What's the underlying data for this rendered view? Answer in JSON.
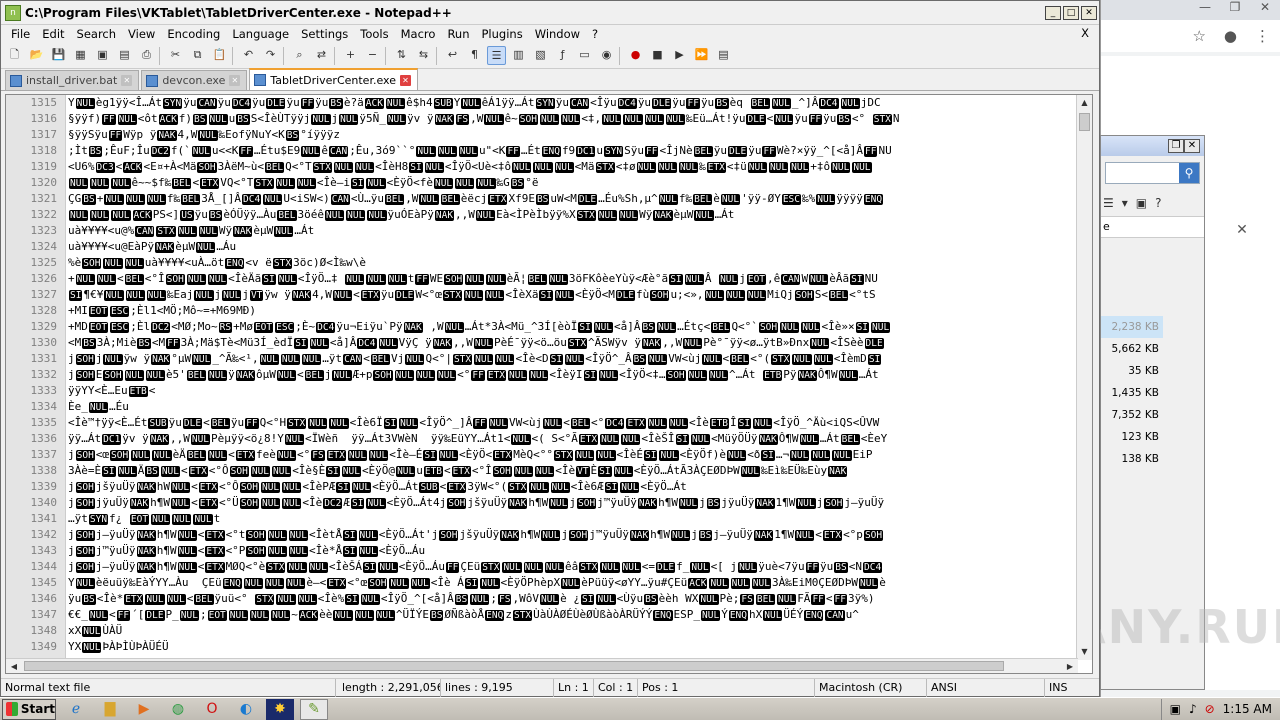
{
  "window": {
    "title": "C:\\Program Files\\VKTablet\\TabletDriverCenter.exe - Notepad++",
    "menu": [
      "File",
      "Edit",
      "Search",
      "View",
      "Encoding",
      "Language",
      "Settings",
      "Tools",
      "Macro",
      "Run",
      "Plugins",
      "Window",
      "?"
    ],
    "menu_close": "X"
  },
  "tabs": [
    {
      "label": "install_driver.bat",
      "active": false
    },
    {
      "label": "devcon.exe",
      "active": false
    },
    {
      "label": "TabletDriverCenter.exe",
      "active": true
    }
  ],
  "editor": {
    "line_numbers": [
      "1315",
      "1316",
      "1317",
      "1318",
      "1319",
      "1320",
      "1321",
      "1322",
      "1323",
      "1324",
      "1325",
      "1326",
      "1327",
      "1328",
      "1329",
      "1330",
      "1331",
      "1332",
      "1333",
      "1334",
      "1335",
      "1336",
      "1337",
      "1338",
      "1339",
      "1340",
      "1341",
      "1342",
      "1343",
      "1344",
      "1345",
      "1346",
      "1347",
      "1348",
      "1349"
    ],
    "lines": [
      "YNULèg1ÿÿ<Î…ÁtSYNÿuCANÿuDC4ÿuDLEÿuFFÿuBSè?äACKNULê$h4SUBYNULê­Á1ÿÿ…ÁtSYNÿuCAN<ÎÿuDC4ÿuDLEÿuFFÿuBSèq BELNUL_^]ÂDC4NULjDC",
      "§ÿÿf)FFNUL<ôtACKf)BSNULuBSS<ÎèÙTÿÿjNULjNULÿ5Ñ_NULÿv ÿNAKFS,WNULê~SOHNULNUL<‡,NULNULNULNUL‰Eü…Át!ÿuDLE<NULÿuFFÿuBS<° STXN",
      "§ÿÿSÿuFFWÿp ÿNAK4,WNUL‰EofÿNuY<KBS°íÿÿÿz",
      ";ÌtBS;ÊuF;ÎuDC2f(`NULu<<KFF…Étu$E9NULêCAN;Êu,3ó9``°NULNULNULu\"<KFF…ÉtENQf9DC1uSYNSÿuFF<ÎjNèBELÿuDLEÿuFFWè?×ÿÿ_^[<å]ÂFFNU",
      "<U6%DC3<ACK<E¤+À<MäSOH3ÀëM~ù<BELQ<°TSTXNULNUL<ÎèH8SINUL<ÎÿÖ<Uè<‡ôNULNULNUL<MäSTX<‡øNULNULNUL‰ETX<‡üNULNULNUL+‡ôNULNUL",
      "NULNULNULê~~$f‰BEL<ETXVQ<°TSTXNULNUL<Îè–iSINUL<ÈÿÖ<fèNULNULNUL‰GBS°ë",
      "ÇGBS+NULNULNULf‰BEL3Å_[]ÂDC4NULU<iSW<)CAN<Ù…ÿuBEL,WNULBELèëcjETXXf9EBSuW<MDLE…Éu%Sh,µ^NULf‰BELèNUL'ÿÿ-ØYESC‰%NULÿÿÿÿENQ",
      "NULNULNULACKPS<]USÿuBSèÓÜÿÿ…ÀuBEL3öéêNULNULNULÿuÓEàPÿNAK,,WNULEà<ÌPèÌbÿÿ%XSTXNULNULWÿNAKèµWNUL…Át",
      "uà¥¥¥¥<u@%CANSTXNULNULWÿNAKèµWNUL…Át",
      "uà¥¥¥¥<u@EàPÿNAKèµWNUL…Áu",
      "%èSOHNULNULuà¥¥¥¥<uÀ…ötENQ<v ëSTX3öc)Ø<Ì‰w\\è",
      "+NULNUL<BEL<°ÎSOHNULNUL<ÎèÄãSINUL<ÎÿÖ…‡ NULNULNULtFFWESOHNULNULèÃ¦BELNUL3öFKôèeYùÿ<Æè°ãSINULÂ NULjEOT,êCANWNULèÂãSINU",
      "SI¶€¥NULNULNUL‰EajNULjNULjVTÿw ÿNAK4,WNUL<ETXÿuDLEW<°œSTXNULNUL<ÎèXäSINUL<ÈÿÖ<MDLEfùSOHu;<»,NULNULNULMiQjSOHS<BEL<°tS",
      "+MIEOTESC;Èl1<MÖ;Mô~=+M69MÐ)",
      "+MDEOTESC;ÈlDC2<MØ;Mo~RS+MøEOTESC;È~DC4ÿu¬Eiÿu`PÿNAK ,WNUL…Át*3À<Mü_^3Í[èòÏSINUL<å]ÂBSNUL…Étç<BELQ<°`SOHNULNUL<Îè»×SINUL",
      "<MBS3À;MièBS<MFF3À;Mä$Tè<Mü3Í_èdÏSINUL<å]ÂDC4NULVÿÇ ÿNAK,,WNULPèÉ¯ÿÿ<ö…öuSTX^ÃSWÿv ÿNAK,,WNULPè°¯ÿÿ<ø…ÿtB»ÐnxNUL<ÎSèèDLE",
      "jSOHjNULÿw ÿNAK°µWNUL_^Ã‰<¹,NULNULNUL…ÿtCAN<BELVjNULQ<°|STXNULNUL<Îè<DSINUL<ÎÿÖ^_ÂBSNULVW<ùjNUL<BEL<°(STXNULNUL<ÎèmDSI",
      "jSOHESOHNULNULè5'BELNULÿNAKôµWNUL<BELjNULÆ+pSOHNULNULNUL<°FFETXNULNUL<ÎèÿISINUL<ÎÿÖ<‡…SOHNULNUL^…Át ETBPÿNAKÔ¶WNUL…Át",
      "ÿÿYY<È…EuETB<",
      "Èe_NUL…Éu",
      "<Îè™†ÿÿ<È…ÉtSUBÿuDLE<BELÿuFFQ<°HSTXNULNUL<Îè6ÏSINUL<ÎÿÖ^_]ÂFFNULVW<ùjNUL<BEL<°DC4ETXNULNUL<ÎèETBÎSINUL<ÎÿÖ_^Äù<iQS<ÛVW",
      "ÿÿ…ÁtDC1ÿv ÿNAK,,WNULPèµÿÿ<ö¿8!YNUL<ÏWèñ  ÿÿ…Át3VWèN  ÿÿ‰EüYY…Át1<NUL<( S<°ÃETXNULNUL<ÎèŠÎSINUL<MüÿÖÜÿNAKÔ¶WNUL…ÁtBEL<ÈeY",
      "jSOH<œSOHNULNULèÄBELNUL<ETXfeèNUL<°FSETXNULNUL<Îè–ÉSINUL<ÈÿÖ<ETXMèQ<°°STXNULNUL<ÎèÉSINUL<ÈÿÖf)èNUL<ðSI…¬NULNULNULEiP",
      "3Àè=ÈSINULÄBSNUL<ETX<°ÔSOHNULNUL<Îè§ÈSINUL<ÈÿÖ@NULuETB<ETX<°ÎSOHNULNUL<ÎèVTÈSINUL<ÈÿÖ…ÁtÃ3ÀÇEØDÞWNUL‰Eì‰EÜ‰EùyNAK",
      "jSOHjšÿuÜÿNAKhWNUL<ETX<°ÔSOHNULNUL<ÎèPÆSINUL<ÈÿÖ…ÁtSUB<ETX3ÿW<°(STXNULNUL<Îè6ÆSINUL<ÈÿÖ…Át",
      "jSOHjÿuÜÿNAKh¶WNUL<ETX<°ÜSOHNULNUL<ÎèDC2ÆSINUL<ÈÿÖ…Át4jSOHjšÿuÜÿNAKh¶WNULjSOHj™ÿuÜÿNAKh¶WNULjBSjÿuÜÿNAK1¶WNULjSOHj—ÿuÜÿ",
      "…ÿtSYNf¿ EOTNULNULNULt",
      "jSOHj—ÿuÜÿNAKh¶WNUL<ETX<°tSOHNULNUL<ÎètÅSINUL<ÈÿÖ…Át'jSOHjšÿuÜÿNAKh¶WNULjSOHj™ÿuÜÿNAKh¶WNULjBSj—ÿuÜÿNAK1¶WNUL<ETX<°pSOH",
      "jSOHj™ÿuÜÿNAKh¶WNUL<ETX<°PSOHNULNUL<Îè*ÅSINUL<ÈÿÖ…Áu",
      "jSOHj—ÿuÜÿNAKh¶WNUL<ETXMØQ<°èSTXNULNUL<ÎèŠÁSINUL<ÈÿÖ…ÁuFFÇEüSTXNULNULNULêâSTXNULNUL<=DLEf_NUL<[ jNULÿuè<7ÿuFFÿuBS<NDC4",
      "YNULèëuüÿ‰EàÝYY…Àu  ÇEüENQNULNULNULè–<ETX<°œSOHNULNUL<Îè ÁSINUL<ÈÿÖPhèpXNULèPüüÿ<øYY…ÿu#ÇEüACKNULNULNUL3À‰EiM0ÇEØDÞWNULè",
      "ÿuBS<Îè*ETXNULNUL<BELÿuü<° STXNULNUL<Îè%SINUL<ÎÿÖ_^[<å]ÂBSNUL;FS,WôVNULè ¿SINUL<ÙÿuBSèèh WXNULPè;FSBELNULFÃFF<FF3ÿ%)",
      "€€_NUL<FF´[DLEP_NUL;EOTNULNULNUL~ACKèèNULNULNUL^ÜÏÝEBSØÑßàòÅENQzSTXÙàÙÀØÉÙèØÙßàòÀRÜÝÝENQESP_NULÝENQhXNULÜÉÝENQCANu^",
      "xXNULÙÀÜ",
      "YXNULÞÀÞÌÙÞÀÜÉÜ"
    ]
  },
  "status": {
    "file_type": "Normal text file",
    "length": "length : 2,291,056",
    "lines": "lines : 9,195",
    "ln": "Ln : 1",
    "col": "Col : 1",
    "pos": "Pos : 1",
    "eol": "Macintosh (CR)",
    "encoding": "ANSI",
    "mode": "INS"
  },
  "explorer": {
    "sizes": [
      "2,238 KB",
      "5,662 KB",
      "35 KB",
      "1,435 KB",
      "7,352 KB",
      "123 KB",
      "138 KB"
    ],
    "header_fragment": "e"
  },
  "taskbar": {
    "start_label": "Start",
    "clock": "1:15 AM"
  },
  "watermark": "ANY.RUN",
  "colors": {
    "control_char_bg": "#000000",
    "active_tab_accent": "#f0a030",
    "gutter_bg": "#e4e4e4"
  }
}
